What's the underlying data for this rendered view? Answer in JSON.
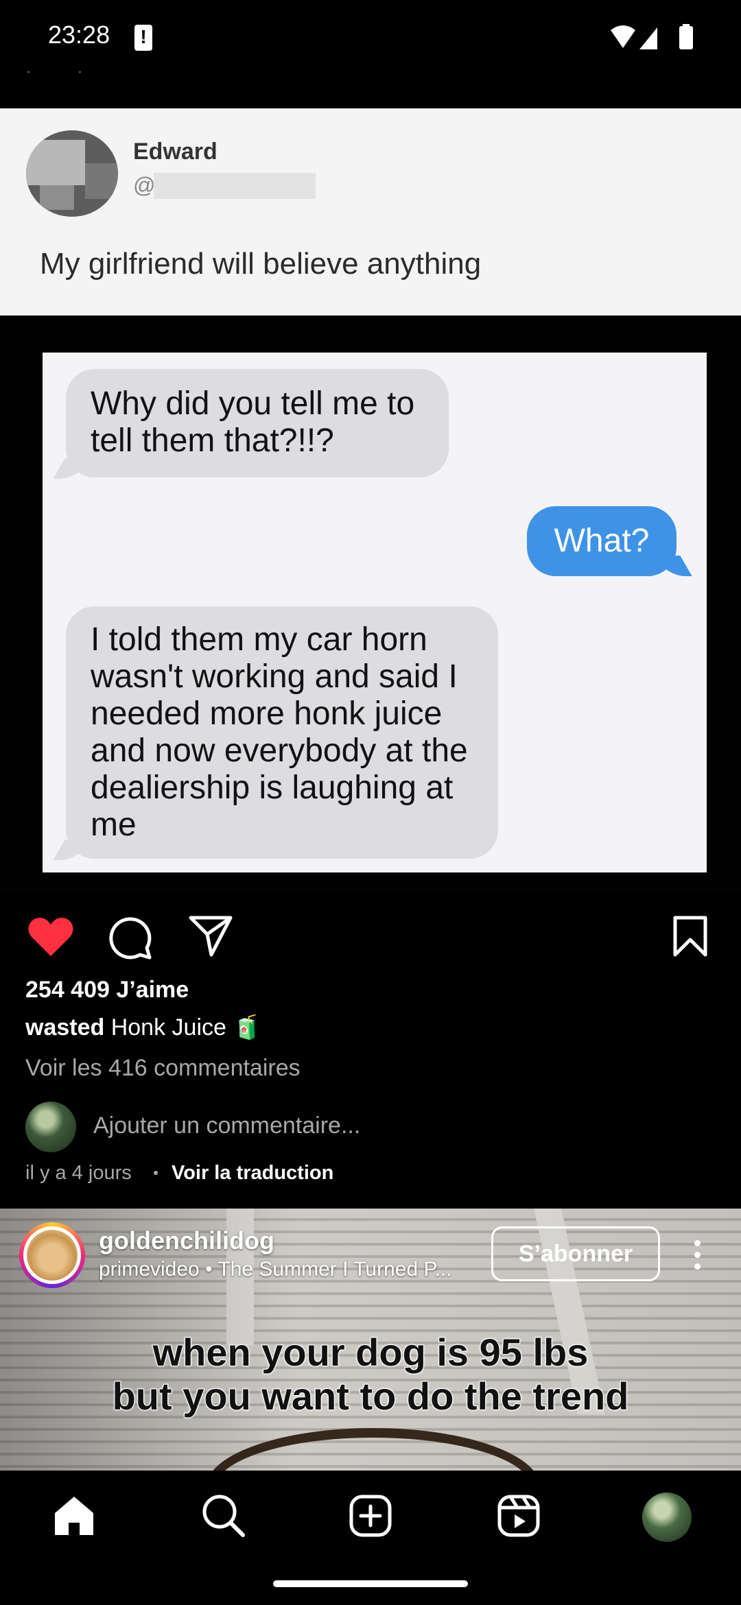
{
  "status_bar": {
    "time": "23:28"
  },
  "tweet": {
    "name": "Edward",
    "handle_prefix": "@",
    "text": "My girlfriend will believe anything"
  },
  "chat": {
    "messages": [
      {
        "from": "them",
        "text": "Why did you tell me to tell them that?!!?"
      },
      {
        "from": "me",
        "text": "What?"
      },
      {
        "from": "them",
        "text": "I told them my car horn wasn't working and said I needed more honk juice and now everybody at the dealiership is laughing at me"
      }
    ]
  },
  "post": {
    "likes": "254 409 J’aime",
    "caption_user": "wasted",
    "caption_text": "Honk Juice 🧃",
    "view_comments": "Voir les 416 commentaires",
    "add_comment_placeholder": "Ajouter un commentaire...",
    "time_ago": "il y a 4 jours",
    "see_translation": "Voir la traduction",
    "liked": true
  },
  "reel": {
    "username": "goldenchilidog",
    "audio": "primevideo • The Summer I Turned P...",
    "follow_label": "S’abonner",
    "caption_line1": "when your dog is 95 lbs",
    "caption_line2": "but you want to do the trend"
  },
  "colors": {
    "like_red": "#ff3040",
    "imessage_blue": "#3f93e6",
    "bubble_grey": "#dcdce1"
  },
  "icons": [
    "wifi-icon",
    "signal-icon",
    "battery-icon",
    "heart-icon",
    "comment-icon",
    "share-icon",
    "bookmark-icon",
    "home-icon",
    "search-icon",
    "create-icon",
    "reels-icon"
  ]
}
